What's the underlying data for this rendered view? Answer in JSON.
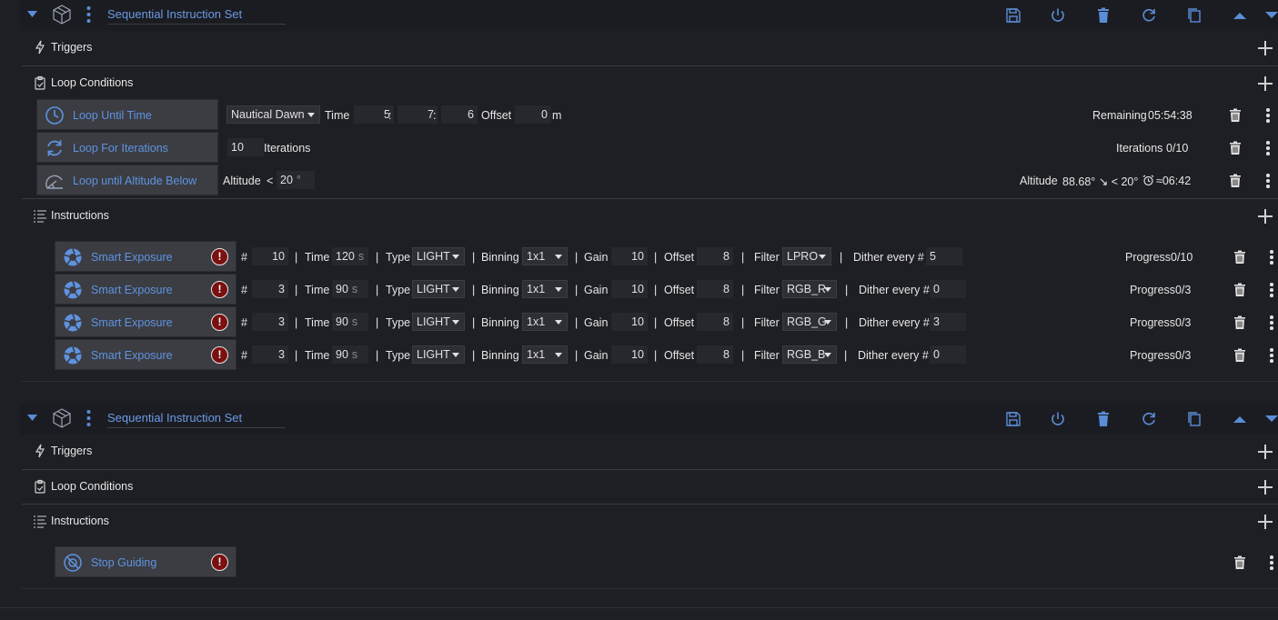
{
  "colors": {
    "accent": "#5a8dd8",
    "background": "#1e1f24",
    "tile": "#3b3d43",
    "warning": "#7a1010"
  },
  "sets": [
    {
      "title": "Sequential Instruction Set",
      "sections": {
        "triggers": "Triggers",
        "loop_conditions": "Loop Conditions",
        "instructions": "Instructions"
      },
      "conditions": [
        {
          "name": "Loop Until Time",
          "source": "Nautical Dawn",
          "time_label": "Time",
          "hours": "5",
          "minutes": "7",
          "seconds": "6",
          "offset_label": "Offset",
          "offset": "0",
          "offset_unit": "m",
          "status_label": "Remaining",
          "status_value": "05:54:38"
        },
        {
          "name": "Loop For Iterations",
          "iterations": "10",
          "iterations_label": "Iterations",
          "status_label": "Iterations",
          "status_value": "0/10"
        },
        {
          "name": "Loop until Altitude Below",
          "altitude_label": "Altitude",
          "comparator": "<",
          "altitude": "20",
          "altitude_unit": "°",
          "status_label": "Altitude",
          "status_value": "88.68° ↘ < 20°",
          "eta": "≈06:42"
        }
      ],
      "instructions": [
        {
          "name": "Smart Exposure",
          "count": "10",
          "time": "120",
          "type": "LIGHT",
          "binning": "1x1",
          "gain": "10",
          "offset": "8",
          "filter": "LPRO",
          "dither": "5",
          "progress": "0/10"
        },
        {
          "name": "Smart Exposure",
          "count": "3",
          "time": "90",
          "type": "LIGHT",
          "binning": "1x1",
          "gain": "10",
          "offset": "8",
          "filter": "RGB_R",
          "dither": "0",
          "progress": "0/3"
        },
        {
          "name": "Smart Exposure",
          "count": "3",
          "time": "90",
          "type": "LIGHT",
          "binning": "1x1",
          "gain": "10",
          "offset": "8",
          "filter": "RGB_G",
          "dither": "3",
          "progress": "0/3"
        },
        {
          "name": "Smart Exposure",
          "count": "3",
          "time": "90",
          "type": "LIGHT",
          "binning": "1x1",
          "gain": "10",
          "offset": "8",
          "filter": "RGB_B",
          "dither": "0",
          "progress": "0/3"
        }
      ]
    },
    {
      "title": "Sequential Instruction Set",
      "sections": {
        "triggers": "Triggers",
        "loop_conditions": "Loop Conditions",
        "instructions": "Instructions"
      },
      "instructions": [
        {
          "name": "Stop Guiding"
        }
      ]
    }
  ],
  "labels": {
    "hash": "#",
    "time": "Time",
    "time_unit": "s",
    "type": "Type",
    "binning": "Binning",
    "gain": "Gain",
    "offset": "Offset",
    "filter": "Filter",
    "dither": "Dither every #",
    "progress": "Progress",
    "pipe": "|",
    "colon": ":"
  }
}
